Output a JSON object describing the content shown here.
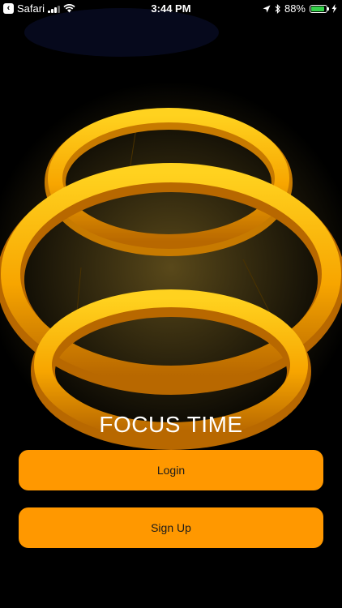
{
  "status_bar": {
    "back_app": "Safari",
    "time": "3:44 PM",
    "battery_percent": "88%",
    "battery_level": 0.88,
    "battery_color": "#35d04a"
  },
  "app": {
    "title": "FOCUS TIME",
    "login_label": "Login",
    "signup_label": "Sign Up",
    "button_color": "#ff9800"
  }
}
